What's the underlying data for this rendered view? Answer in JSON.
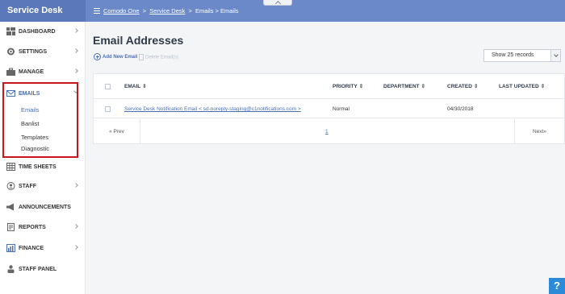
{
  "header": {
    "brand": "Service Desk",
    "breadcrumb": {
      "root": "Comodo One",
      "section": "Service Desk",
      "current": "Emails > Emails",
      "separator": ">"
    }
  },
  "sidebar": {
    "items": [
      {
        "label": "DASHBOARD",
        "icon": "dashboard-icon"
      },
      {
        "label": "SETTINGS",
        "icon": "gear-icon"
      },
      {
        "label": "MANAGE",
        "icon": "briefcase-icon"
      },
      {
        "label": "EMAILS",
        "icon": "envelope-icon"
      },
      {
        "label": "TIME SHEETS",
        "icon": "grid-icon"
      },
      {
        "label": "STAFF",
        "icon": "user-icon"
      },
      {
        "label": "ANNOUNCEMENTS",
        "icon": "megaphone-icon"
      },
      {
        "label": "REPORTS",
        "icon": "report-icon"
      },
      {
        "label": "FINANCE",
        "icon": "bar-chart-icon"
      },
      {
        "label": "STAFF PANEL",
        "icon": "person-icon"
      }
    ],
    "emails_sub": [
      "Emails",
      "Banlist",
      "Templates",
      "Diagnostic"
    ],
    "highlight_color": "#c8161d"
  },
  "main": {
    "title": "Email Addresses",
    "add_label": "Add New Email",
    "delete_label": "Delete Email(s)",
    "show_records": "Show 25 records",
    "table": {
      "columns": [
        "EMAIL",
        "PRIORITY",
        "DEPARTMENT",
        "CREATED",
        "LAST UPDATED"
      ],
      "sort_symbol": "⇕",
      "rows": [
        {
          "email": "Service Desk Notification Email < sd-noreply-staging@c1notifications.com >",
          "priority": "Normal",
          "department": "",
          "created": "04/30/2018",
          "last_updated": ""
        }
      ]
    },
    "pager": {
      "prev": "« Prev",
      "page": "1",
      "next": "Next»"
    }
  },
  "help": "?",
  "colors": {
    "header": "#6b89c9",
    "brand_bg": "#5b78bb",
    "link": "#4a6fb5",
    "help": "#2d8ad9"
  }
}
